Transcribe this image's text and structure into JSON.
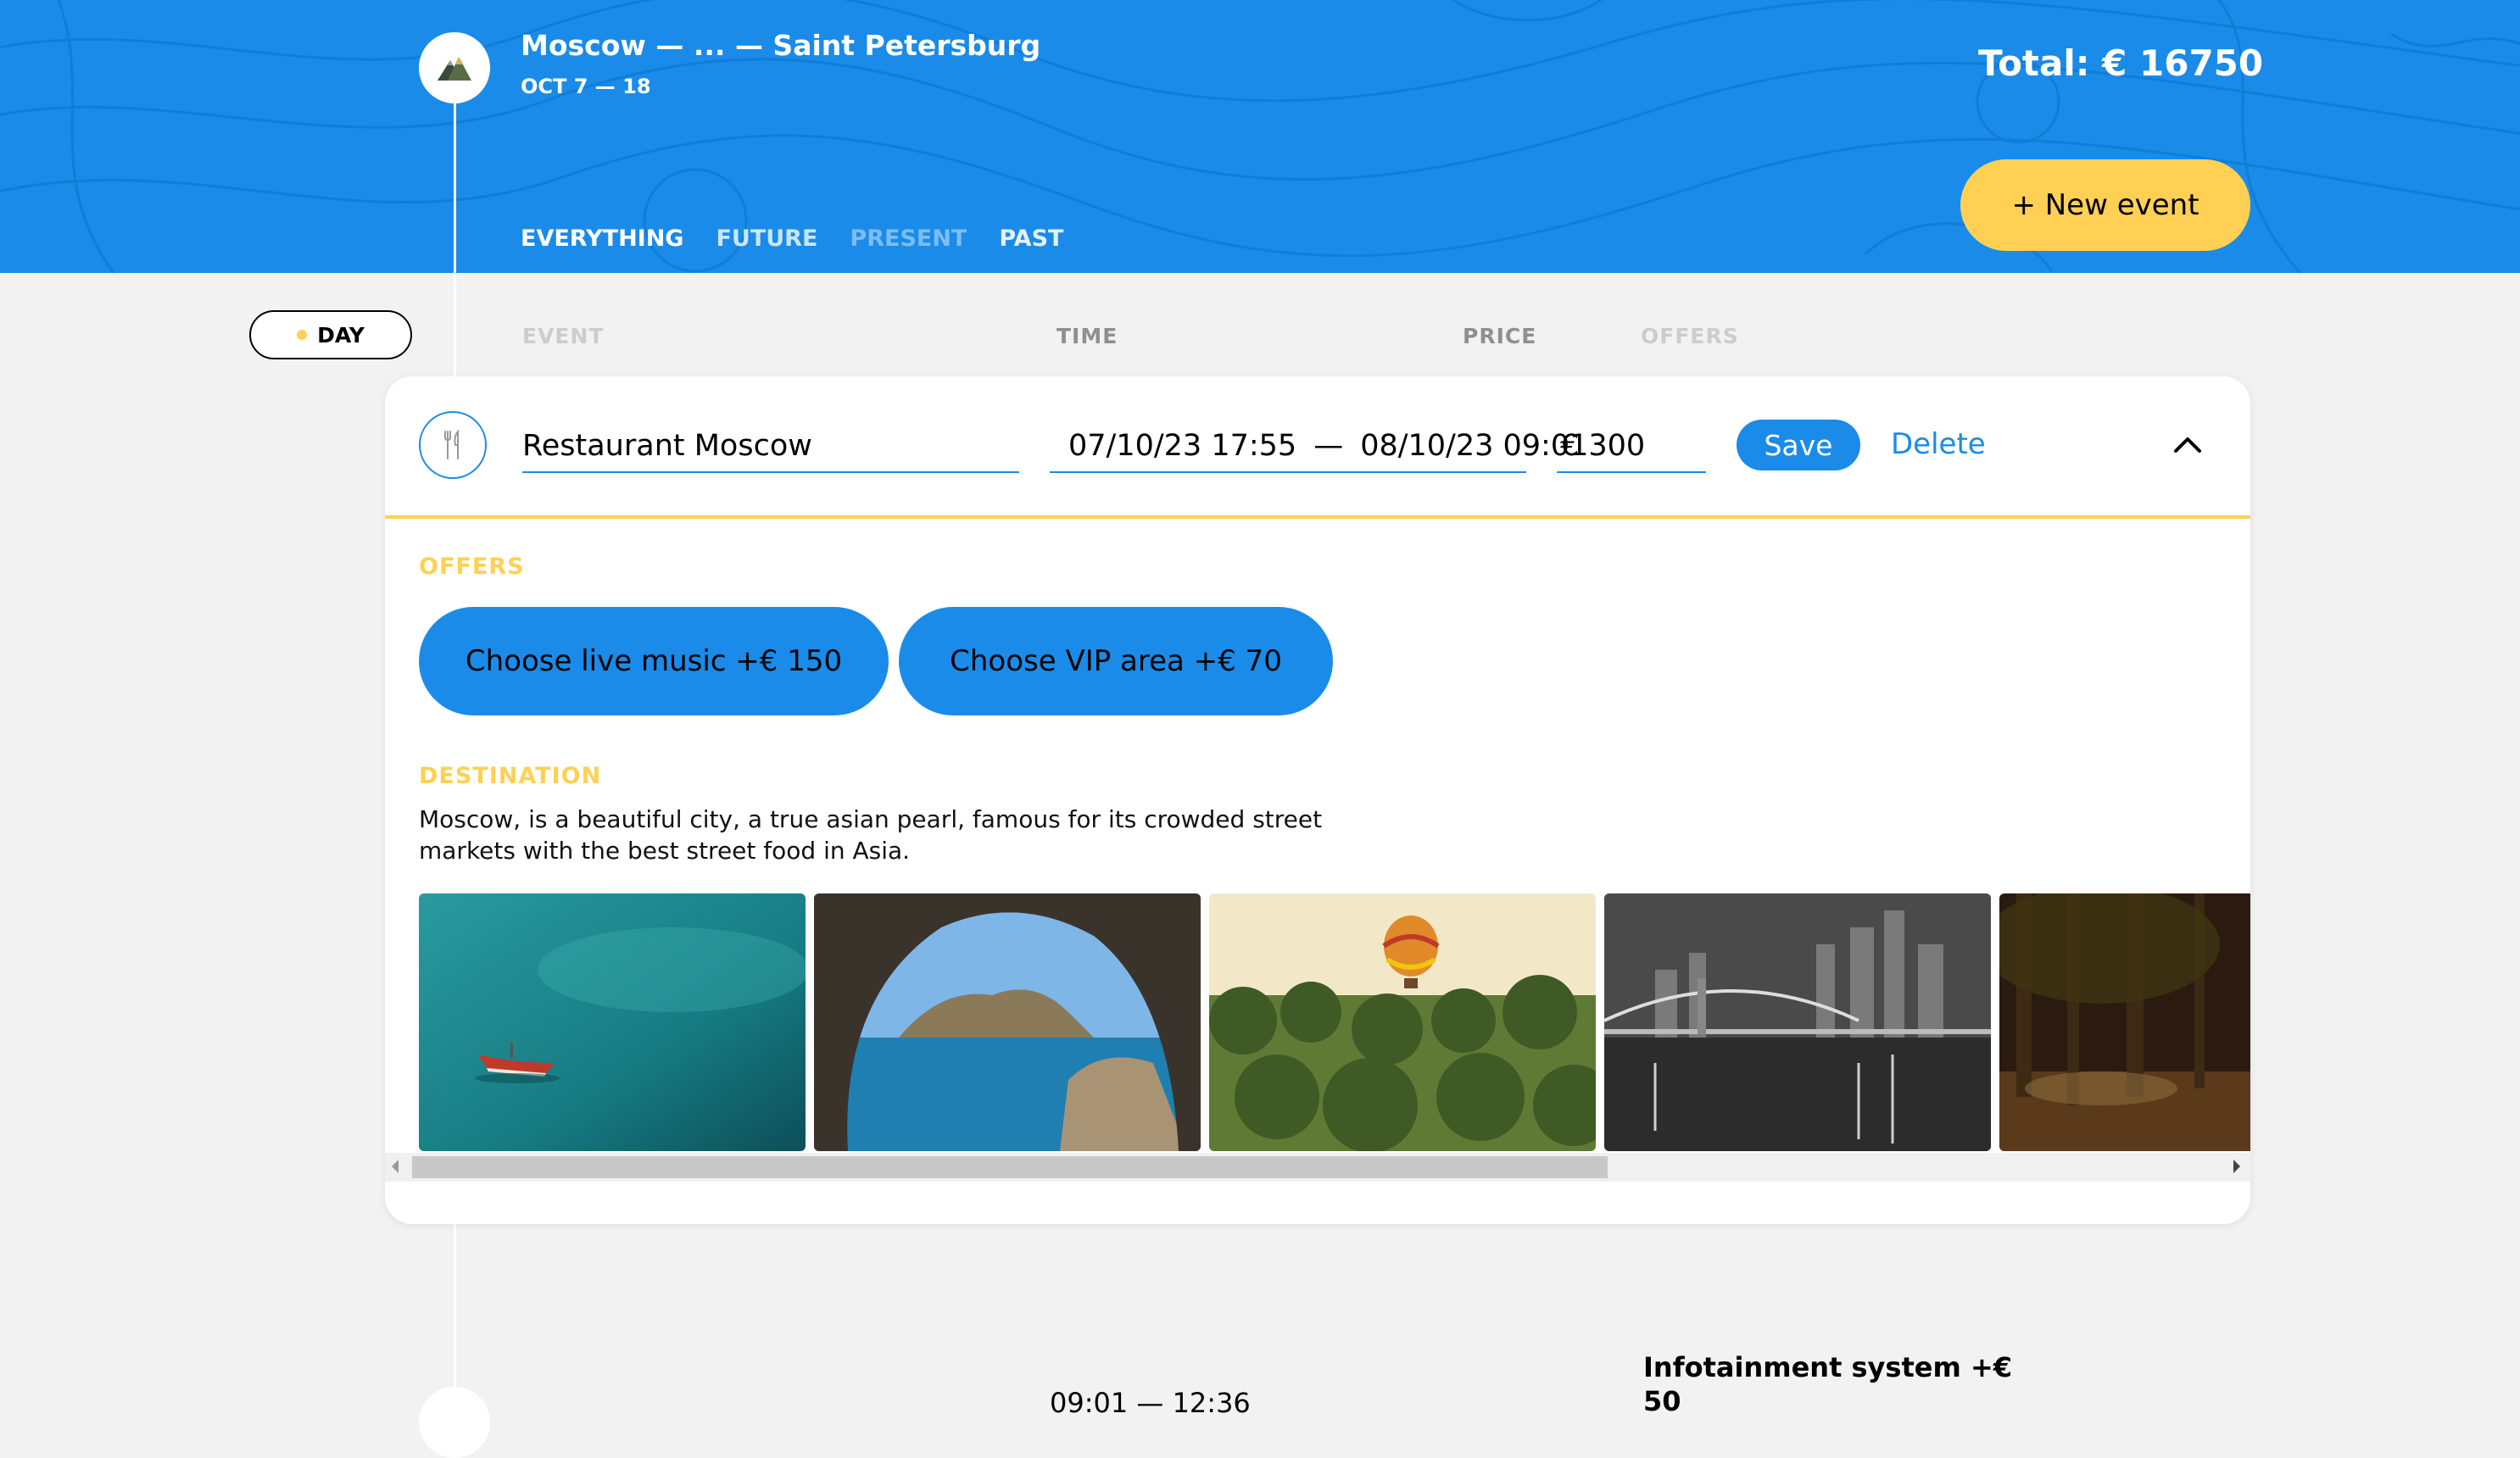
{
  "header": {
    "trip_title": "Moscow — ... — Saint Petersburg",
    "trip_dates": "OCT 7 — 18",
    "total": "Total: € 16750",
    "new_event_label": "+ New event",
    "logo_icon": "mountains-icon",
    "filters": [
      {
        "label": "EVERYTHING",
        "state": "active"
      },
      {
        "label": "FUTURE",
        "state": "inactive"
      },
      {
        "label": "PRESENT",
        "state": "disabled"
      },
      {
        "label": "PAST",
        "state": "inactive"
      }
    ]
  },
  "sort": {
    "day_label": "DAY",
    "event_label": "EVENT",
    "time_label": "TIME",
    "price_label": "PRICE",
    "offers_label": "OFFERS"
  },
  "edit_form": {
    "type_icon": "restaurant-icon",
    "destination_value": "Restaurant Moscow",
    "start_time": "07/10/23 17:55",
    "time_separator": "—",
    "end_time": "08/10/23 09:01",
    "price_value": "€ 300",
    "save_label": "Save",
    "delete_label": "Delete",
    "collapse_icon": "chevron-up-icon",
    "offers_title": "OFFERS",
    "offers": [
      {
        "label": "Choose live music +€  150"
      },
      {
        "label": "Choose VIP area +€  70"
      }
    ],
    "destination_title": "DESTINATION",
    "destination_description": "Moscow, is a beautiful city, a true asian pearl, famous for its crowded street markets with the best street food in Asia.",
    "photos": [
      "sea-boat-photo",
      "sea-cave-photo",
      "balloon-palms-photo",
      "bridge-city-night-photo",
      "forest-photo"
    ]
  },
  "next_event": {
    "time": "09:01 — 12:36",
    "offer_text": "Infotainment system +€",
    "offer_price": "50"
  },
  "colors": {
    "primary": "#1a8be8",
    "accent": "#ffd054",
    "background": "#f2f2f2"
  }
}
